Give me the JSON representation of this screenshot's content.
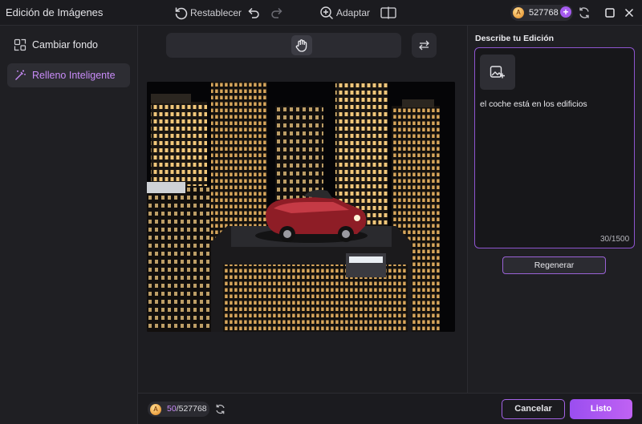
{
  "window": {
    "title": "Edición de Imágenes",
    "credits": "527768"
  },
  "sidebar": {
    "items": [
      {
        "label": "Cambiar fondo",
        "icon": "change-background-icon",
        "active": false
      },
      {
        "label": "Relleno Inteligente",
        "icon": "magic-wand-icon",
        "active": true
      }
    ]
  },
  "toolbar": {
    "reset_label": "Restablecer",
    "fit_label": "Adaptar"
  },
  "panel": {
    "title": "Describe tu Edición",
    "prompt_text": "el coche está en los edificios",
    "char_count": "30/1500",
    "regenerate_label": "Regenerar"
  },
  "footer": {
    "cost_used": "50",
    "cost_total": "/527768",
    "cancel_label": "Cancelar",
    "done_label": "Listo"
  },
  "colors": {
    "accent": "#a55bf0",
    "active_text": "#c98cf9"
  }
}
